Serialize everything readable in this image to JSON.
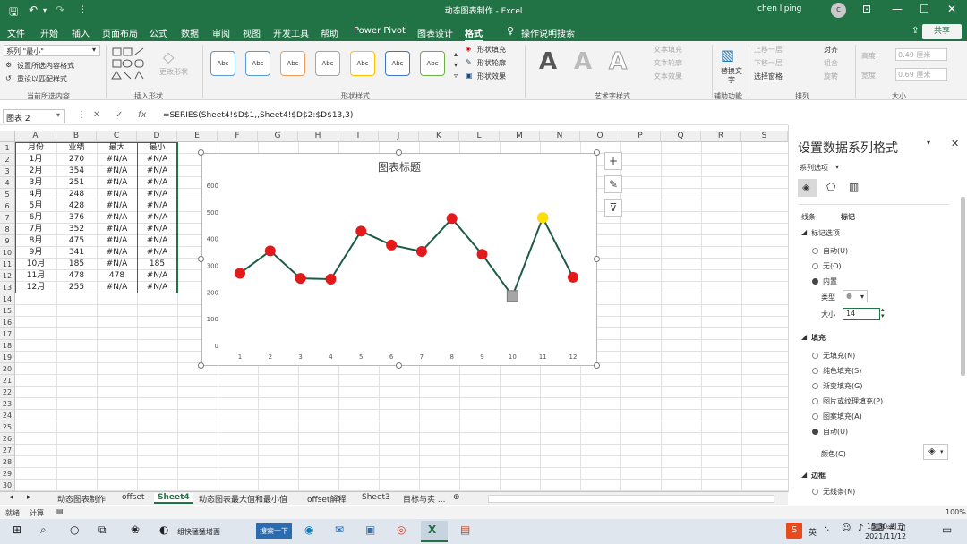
{
  "window": {
    "title": "动态图表制作 - Excel",
    "user": "chen liping",
    "avatar_text": "c"
  },
  "menu": [
    {
      "label": "文件"
    },
    {
      "label": "开始"
    },
    {
      "label": "插入"
    },
    {
      "label": "页面布局"
    },
    {
      "label": "公式"
    },
    {
      "label": "数据"
    },
    {
      "label": "审阅"
    },
    {
      "label": "视图"
    },
    {
      "label": "开发工具"
    },
    {
      "label": "帮助"
    },
    {
      "label": "Power Pivot"
    },
    {
      "label": "图表设计"
    },
    {
      "label": "格式"
    },
    {
      "label": "操作说明搜索"
    }
  ],
  "share_label": "共享",
  "ribbon": {
    "selection_dropdown": "系列 \"最小\"",
    "format_selection": "设置所选内容格式",
    "reset_style": "重设以匹配样式",
    "group_current": "当前所选内容",
    "change_shape": "更改形状",
    "group_insert_shapes": "插入形状",
    "shape_style_sample": "Abc",
    "shape_fill": "形状填充",
    "shape_outline": "形状轮廓",
    "shape_effects": "形状效果",
    "group_shape_styles": "形状样式",
    "wordart_letter": "A",
    "text_fill": "文本填充",
    "text_outline": "文本轮廓",
    "text_effects": "文本效果",
    "group_wordart": "艺术字样式",
    "alt_text": "替换文字",
    "group_accessibility": "辅助功能",
    "bring_forward": "上移一层",
    "send_backward": "下移一层",
    "selection_pane": "选择窗格",
    "align": "对齐",
    "group": "组合",
    "rotate": "旋转",
    "group_arrange": "排列",
    "height_label": "高度:",
    "height_value": "0.49 厘米",
    "width_label": "宽度:",
    "width_value": "0.69 厘米",
    "group_size": "大小"
  },
  "formula_bar": {
    "name_box": "图表 2",
    "formula": "=SERIES(Sheet4!$D$1,,Sheet4!$D$2:$D$13,3)"
  },
  "columns": [
    "A",
    "B",
    "C",
    "D",
    "E",
    "F",
    "G",
    "H",
    "I",
    "J",
    "K",
    "L",
    "M",
    "N",
    "O",
    "P",
    "Q",
    "R",
    "S"
  ],
  "rows": [
    "1",
    "2",
    "3",
    "4",
    "5",
    "6",
    "7",
    "8",
    "9",
    "10",
    "11",
    "12",
    "13",
    "14",
    "15",
    "16",
    "17",
    "18",
    "19",
    "20",
    "21",
    "22",
    "23",
    "24",
    "25",
    "26",
    "27",
    "28",
    "29",
    "30"
  ],
  "table": {
    "headers": [
      "月份",
      "业绩",
      "最大",
      "最小"
    ],
    "rows": [
      [
        "1月",
        "270",
        "#N/A",
        "#N/A"
      ],
      [
        "2月",
        "354",
        "#N/A",
        "#N/A"
      ],
      [
        "3月",
        "251",
        "#N/A",
        "#N/A"
      ],
      [
        "4月",
        "248",
        "#N/A",
        "#N/A"
      ],
      [
        "5月",
        "428",
        "#N/A",
        "#N/A"
      ],
      [
        "6月",
        "376",
        "#N/A",
        "#N/A"
      ],
      [
        "7月",
        "352",
        "#N/A",
        "#N/A"
      ],
      [
        "8月",
        "475",
        "#N/A",
        "#N/A"
      ],
      [
        "9月",
        "341",
        "#N/A",
        "#N/A"
      ],
      [
        "10月",
        "185",
        "#N/A",
        "185"
      ],
      [
        "11月",
        "478",
        "478",
        "#N/A"
      ],
      [
        "12月",
        "255",
        "#N/A",
        "#N/A"
      ]
    ]
  },
  "chart_data": {
    "type": "line",
    "title": "图表标题",
    "categories": [
      "1",
      "2",
      "3",
      "4",
      "5",
      "6",
      "7",
      "8",
      "9",
      "10",
      "11",
      "12"
    ],
    "series": [
      {
        "values": [
          270,
          354,
          251,
          248,
          428,
          376,
          352,
          475,
          341,
          185,
          478,
          255
        ],
        "color": "#1e5b46",
        "marker": "#e31a1c"
      },
      {
        "values": [
          null,
          null,
          null,
          null,
          null,
          null,
          null,
          null,
          null,
          null,
          478,
          null
        ],
        "marker": "#ffe000"
      },
      {
        "values": [
          null,
          null,
          null,
          null,
          null,
          null,
          null,
          null,
          null,
          185,
          null,
          null
        ],
        "marker": "#a6a6a6"
      }
    ],
    "ylim": [
      0,
      600
    ],
    "yticks": [
      "0",
      "100",
      "200",
      "300",
      "400",
      "500",
      "600"
    ],
    "grid": false
  },
  "chart_buttons": {
    "add": "+",
    "style": "✎",
    "filter": "⊽"
  },
  "format_panel": {
    "title": "设置数据系列格式",
    "series_options": "系列选项",
    "tab_line": "线条",
    "tab_marker": "标记",
    "marker_options": "标记选项",
    "auto": "自动(U)",
    "none": "无(O)",
    "builtin": "内置",
    "type_label": "类型",
    "type_value": "●",
    "size_label": "大小",
    "size_value": "14",
    "fill_section": "填充",
    "fill_none": "无填充(N)",
    "fill_solid": "纯色填充(S)",
    "fill_gradient": "渐变填充(G)",
    "fill_picture": "图片或纹理填充(P)",
    "fill_pattern": "图案填充(A)",
    "fill_auto": "自动(U)",
    "color_label": "颜色(C)",
    "border_section": "边框",
    "border_none": "无线条(N)"
  },
  "sheets": [
    {
      "label": "动态图表制作"
    },
    {
      "label": "offset"
    },
    {
      "label": "Sheet4"
    },
    {
      "label": "动态图表最大值和最小值"
    },
    {
      "label": "offset解释"
    },
    {
      "label": "Sheet3"
    },
    {
      "label": "目标与实 ..."
    }
  ],
  "status": {
    "ready": "就绪",
    "calc": "计算",
    "zoom": "100%"
  },
  "taskbar": {
    "search_window": "组快猛猛增面",
    "edge_tab": "搜索一下",
    "ime": "英",
    "time": "15:30 周五",
    "date": "2021/11/12"
  }
}
